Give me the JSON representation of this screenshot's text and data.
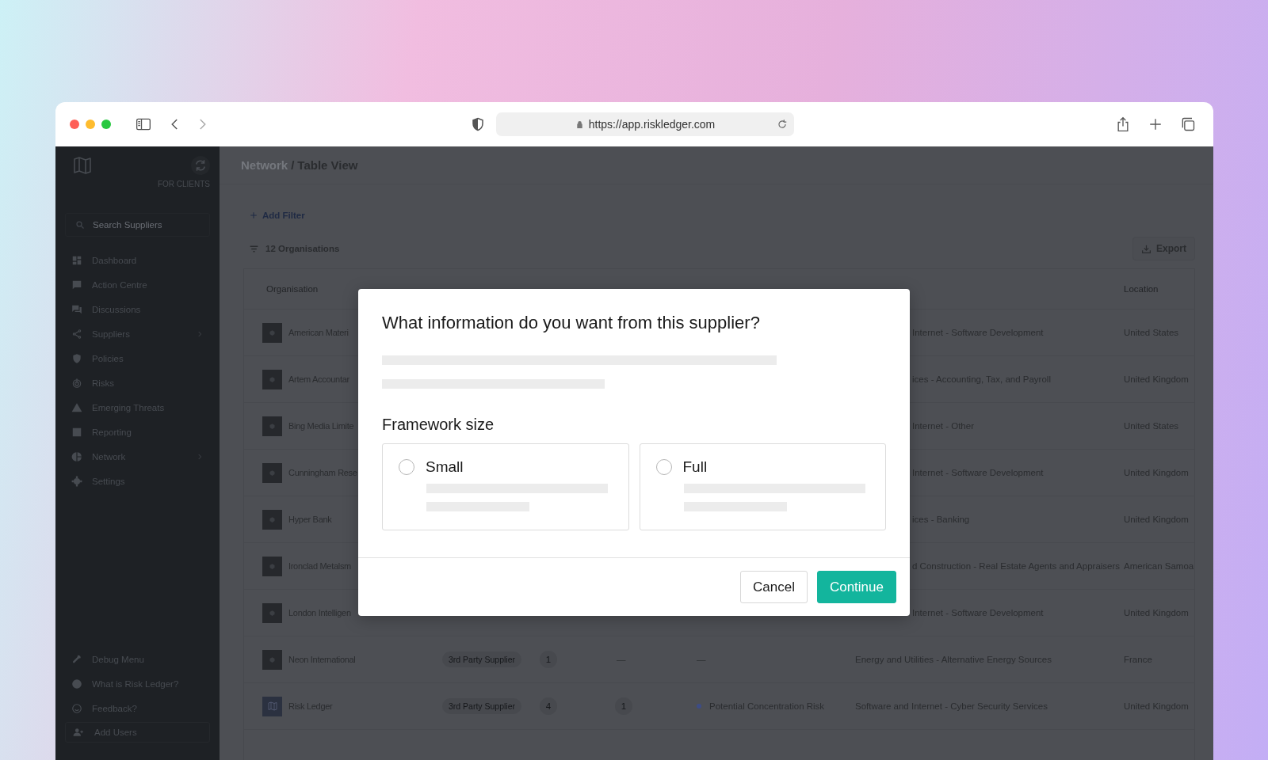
{
  "browser": {
    "url": "https://app.riskledger.com"
  },
  "sidebar": {
    "caption": "FOR CLIENTS",
    "search": {
      "placeholder": "Search Suppliers"
    },
    "items": [
      {
        "label": "Dashboard",
        "expandable": false
      },
      {
        "label": "Action Centre",
        "expandable": false
      },
      {
        "label": "Discussions",
        "expandable": false
      },
      {
        "label": "Suppliers",
        "expandable": true
      },
      {
        "label": "Policies",
        "expandable": false
      },
      {
        "label": "Risks",
        "expandable": false
      },
      {
        "label": "Emerging Threats",
        "expandable": false
      },
      {
        "label": "Reporting",
        "expandable": false
      },
      {
        "label": "Network",
        "expandable": true
      },
      {
        "label": "Settings",
        "expandable": false
      }
    ],
    "footer_items": [
      {
        "label": "Debug Menu"
      },
      {
        "label": "What is Risk Ledger?"
      },
      {
        "label": "Feedback?"
      }
    ],
    "add_users": "Add Users"
  },
  "breadcrumb": {
    "parent": "Network",
    "separator": "/",
    "current": "Table View"
  },
  "add_filter": "Add Filter",
  "count": "12 Organisations",
  "export": "Export",
  "table": {
    "columns": [
      {
        "label": "Organisation"
      },
      {
        "label": "Location"
      }
    ],
    "rows": [
      {
        "kind": "placeholder",
        "name": "American Materi",
        "industry": "Internet - Software Development",
        "location": "United States"
      },
      {
        "kind": "placeholder",
        "name": "Artem Accountar",
        "industry": "ices - Accounting, Tax, and Payroll",
        "location": "United Kingdom"
      },
      {
        "kind": "placeholder",
        "name": "Bing Media Limite",
        "industry": "Internet - Other",
        "location": "United States"
      },
      {
        "kind": "placeholder",
        "name": "Cunningham Rese",
        "industry": "Internet - Software Development",
        "location": "United Kingdom"
      },
      {
        "kind": "placeholder",
        "name": "Hyper Bank",
        "industry": "ices - Banking",
        "location": "United Kingdom"
      },
      {
        "kind": "placeholder",
        "name": "Ironclad Metalsm",
        "industry": "d Construction - Real Estate Agents and Appraisers",
        "location": "American Samoa"
      },
      {
        "kind": "placeholder",
        "name": "London Intelligen",
        "industry": "Internet - Software Development",
        "location": "United Kingdom"
      },
      {
        "kind": "placeholder",
        "name": "Neon International",
        "type": "3rd Party Supplier",
        "count": "1",
        "column_4": "—",
        "risk": {
          "label": "—"
        },
        "industry": "Energy and Utilities - Alternative Energy Sources",
        "location": "France"
      },
      {
        "kind": "logo",
        "name": "Risk Ledger",
        "type": "3rd Party Supplier",
        "count": "4",
        "column_4": "1",
        "risk": {
          "label": "Potential Concentration Risk",
          "color": "#3d4c86"
        },
        "industry": "Software and Internet - Cyber Security Services",
        "location": "United Kingdom"
      }
    ]
  },
  "modal": {
    "title": "What information do you want from this supplier?",
    "section": "Framework size",
    "options": [
      {
        "label": "Small",
        "selected": false
      },
      {
        "label": "Full",
        "selected": false
      }
    ],
    "buttons": [
      {
        "label": "Cancel",
        "kind": "secondary"
      },
      {
        "label": "Continue",
        "kind": "primary"
      }
    ]
  }
}
